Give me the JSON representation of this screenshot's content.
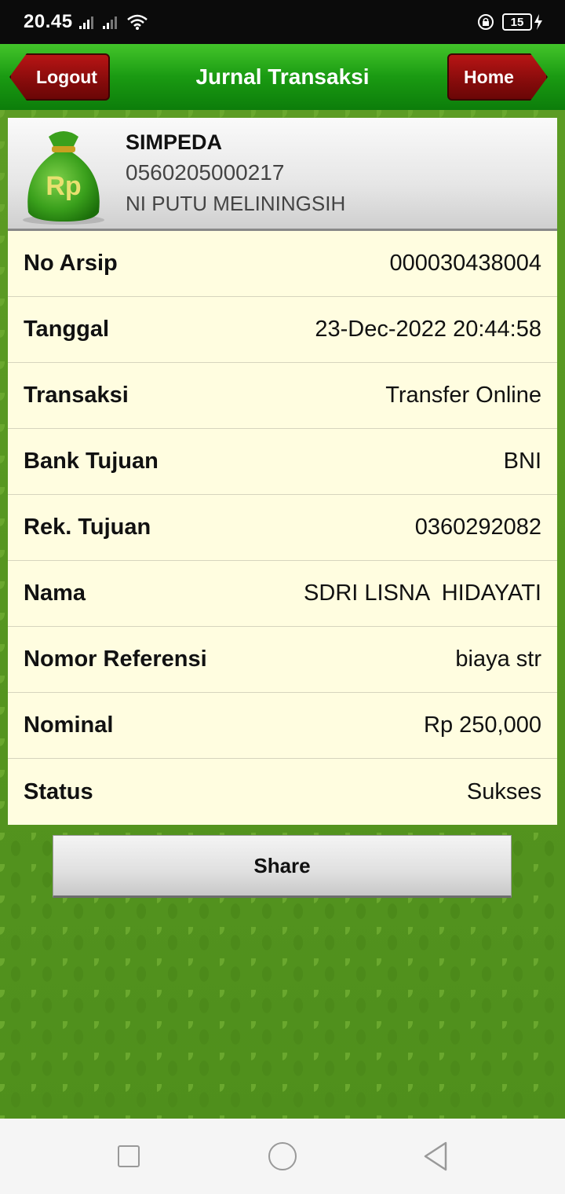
{
  "status_bar": {
    "time": "20.45",
    "battery_level": "15",
    "icons": [
      "signal-icon",
      "signal-icon",
      "wifi-icon",
      "lock-rotation-icon",
      "battery-icon",
      "charging-icon"
    ]
  },
  "header": {
    "title": "Jurnal Transaksi",
    "logout_label": "Logout",
    "home_label": "Home"
  },
  "account": {
    "icon_text": "Rp",
    "type": "SIMPEDA",
    "number": "0560205000217",
    "name": "NI PUTU MELININGSIH"
  },
  "details": [
    {
      "label": "No Arsip",
      "value": "000030438004"
    },
    {
      "label": "Tanggal",
      "value": "23-Dec-2022 20:44:58"
    },
    {
      "label": "Transaksi",
      "value": "Transfer Online"
    },
    {
      "label": "Bank Tujuan",
      "value": "BNI"
    },
    {
      "label": "Rek. Tujuan",
      "value": "0360292082"
    },
    {
      "label": "Nama",
      "value": "SDRI LISNA  HIDAYATI"
    },
    {
      "label": "Nomor Referensi",
      "value": "biaya str"
    },
    {
      "label": "Nominal",
      "value": "Rp 250,000"
    },
    {
      "label": "Status",
      "value": "Sukses"
    }
  ],
  "share_label": "Share",
  "colors": {
    "header_green": "#1a9a12",
    "button_red": "#8a0c0c",
    "table_bg": "#fffde0",
    "pattern_green": "#5a9a22"
  }
}
